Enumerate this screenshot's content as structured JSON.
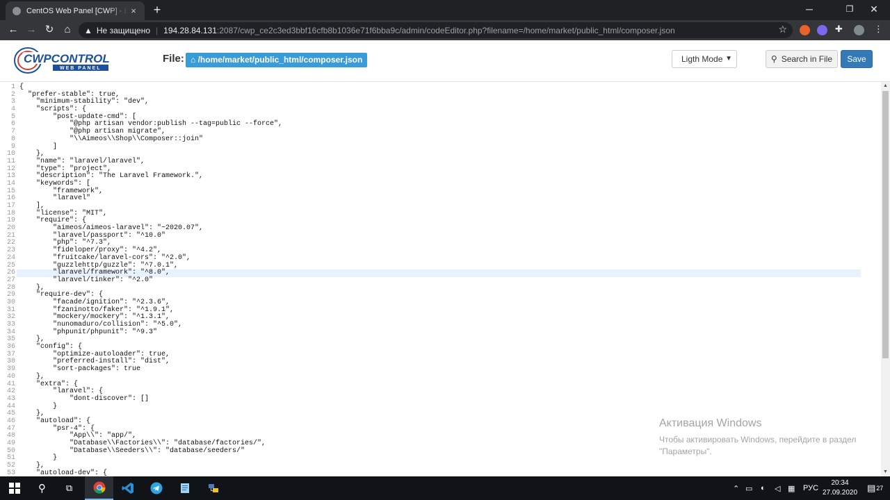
{
  "browser": {
    "tab_title": "CentOS Web Panel [CWP] - Editor",
    "new_tab": "+",
    "close_tab": "×",
    "not_secure": "Не защищено",
    "url_host": "194.28.84.131",
    "url_rest": ":2087/cwp_ce2c3ed3bbf16cfb8b1036e71f6bba9c/admin/codeEditor.php?filename=/home/market/public_html/composer.json"
  },
  "header": {
    "logo_main": "CWPCONTROL",
    "logo_sub": "WEB PANEL",
    "file_label": "File:",
    "file_path": "/home/market/public_html/composer.json",
    "mode_selected": "Ligth Mode",
    "search_label": "Search in File",
    "save_label": "Save"
  },
  "editor": {
    "active_line": 26,
    "lines": [
      "{",
      "  \"prefer-stable\": true,",
      "    \"minimum-stability\": \"dev\",",
      "    \"scripts\": {",
      "        \"post-update-cmd\": [",
      "            \"@php artisan vendor:publish --tag=public --force\",",
      "            \"@php artisan migrate\",",
      "            \"\\\\Aimeos\\\\Shop\\\\Composer::join\"",
      "        ]",
      "    },",
      "    \"name\": \"laravel/laravel\",",
      "    \"type\": \"project\",",
      "    \"description\": \"The Laravel Framework.\",",
      "    \"keywords\": [",
      "        \"framework\",",
      "        \"laravel\"",
      "    ],",
      "    \"license\": \"MIT\",",
      "    \"require\": {",
      "        \"aimeos/aimeos-laravel\": \"~2020.07\",",
      "        \"laravel/passport\": \"^10.0\"",
      "        \"php\": \"^7.3\",",
      "        \"fideloper/proxy\": \"^4.2\",",
      "        \"fruitcake/laravel-cors\": \"^2.0\",",
      "        \"guzzlehttp/guzzle\": \"^7.0.1\",",
      "        \"laravel/framework\": \"^8.0\",",
      "        \"laravel/tinker\": \"^2.0\"",
      "    },",
      "    \"require-dev\": {",
      "        \"facade/ignition\": \"^2.3.6\",",
      "        \"fzaninotto/faker\": \"^1.9.1\",",
      "        \"mockery/mockery\": \"^1.3.1\",",
      "        \"nunomaduro/collision\": \"^5.0\",",
      "        \"phpunit/phpunit\": \"^9.3\"",
      "    },",
      "    \"config\": {",
      "        \"optimize-autoloader\": true,",
      "        \"preferred-install\": \"dist\",",
      "        \"sort-packages\": true",
      "    },",
      "    \"extra\": {",
      "        \"laravel\": {",
      "            \"dont-discover\": []",
      "        }",
      "    },",
      "    \"autoload\": {",
      "        \"psr-4\": {",
      "            \"App\\\\\": \"app/\",",
      "            \"Database\\\\Factories\\\\\": \"database/factories/\",",
      "            \"Database\\\\Seeders\\\\\": \"database/seeders/\"",
      "        }",
      "    },",
      "    \"autoload-dev\": {"
    ]
  },
  "watermark": {
    "title": "Активация Windows",
    "line1": "Чтобы активировать Windows, перейдите в раздел",
    "line2": "\"Параметры\"."
  },
  "taskbar": {
    "lang": "РУС",
    "time": "20:34",
    "date": "27.09.2020",
    "notif_count": "27"
  },
  "colors": {
    "accent": "#337ab7",
    "file_badge": "#3a9bd9",
    "active_line": "#e8f2fe"
  }
}
